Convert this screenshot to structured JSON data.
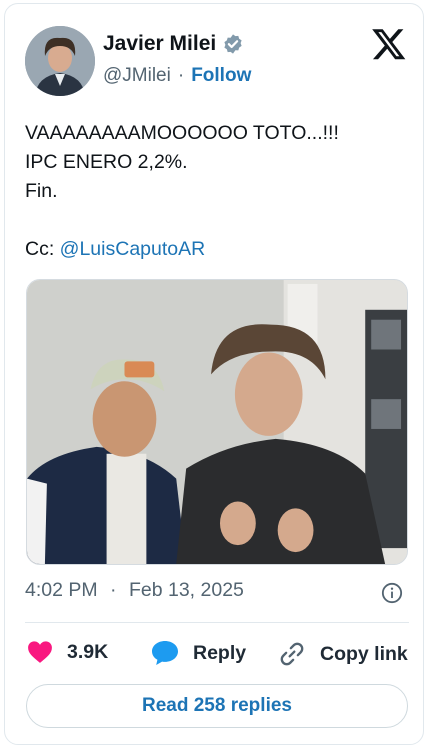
{
  "author": {
    "name": "Javier Milei",
    "handle": "@JMilei",
    "separator": "·",
    "follow_label": "Follow"
  },
  "colors": {
    "link": "#1d74b5",
    "like": "#f91880",
    "secondary_text": "#536471"
  },
  "icons": {
    "verified": "verified-badge-icon",
    "platform": "x-logo-icon",
    "info": "info-icon",
    "like": "heart-icon",
    "reply": "speech-bubble-icon",
    "copy": "link-icon"
  },
  "tweet": {
    "lines": [
      "VAAAAAAAAMOOOOOO TOTO...!!!",
      "IPC ENERO 2,2%.",
      "Fin.",
      ""
    ],
    "cc_prefix": "Cc: ",
    "cc_mention": "@LuisCaputoAR"
  },
  "meta": {
    "time": "4:02 PM",
    "separator": "·",
    "date": "Feb 13, 2025"
  },
  "actions": {
    "likes": "3.9K",
    "reply_label": "Reply",
    "copy_label": "Copy link"
  },
  "read_replies_label": "Read 258 replies"
}
